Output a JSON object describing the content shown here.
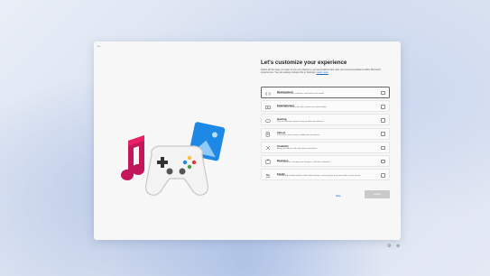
{
  "header": {
    "back_glyph": "←"
  },
  "main": {
    "title": "Let's customize your experience",
    "description": "Select all the ways you plan to use your device to get personalized tips, ads, and recommendations within Microsoft experiences. You can always change this in Settings.",
    "learn_more": "Learn more",
    "options": [
      {
        "name": "Development",
        "desc": "Build beautiful apps, websites, and tools for the world.",
        "icon": "code-icon",
        "selected": true
      },
      {
        "name": "Entertainment",
        "desc": "Watch videos, browse the web, connect on social media.",
        "icon": "entertainment-icon",
        "selected": false
      },
      {
        "name": "Gaming",
        "desc": "Play and discover games, keep up with new releases.",
        "icon": "gaming-icon",
        "selected": false
      },
      {
        "name": "School",
        "desc": "Take notes, write essays, collaborate on projects.",
        "icon": "school-icon",
        "selected": false
      },
      {
        "name": "Creativity",
        "desc": "Bring your ideas to life with photos and videos.",
        "icon": "creativity-icon",
        "selected": false
      },
      {
        "name": "Business",
        "desc": "Track expenses, manage your business, chat with customers.",
        "icon": "business-icon",
        "selected": false
      },
      {
        "name": "Family",
        "desc": "Connect with family members with safety settings, and everyone their own profile on this device.",
        "icon": "family-icon",
        "selected": false
      }
    ],
    "skip_label": "Skip",
    "accept_label": "Accept"
  },
  "tray": {
    "left_icon": "accessibility-icon",
    "right_icon": "language-icon"
  },
  "colors": {
    "accent": "#1a62c4",
    "disabled_button": "#c9c9c9"
  }
}
